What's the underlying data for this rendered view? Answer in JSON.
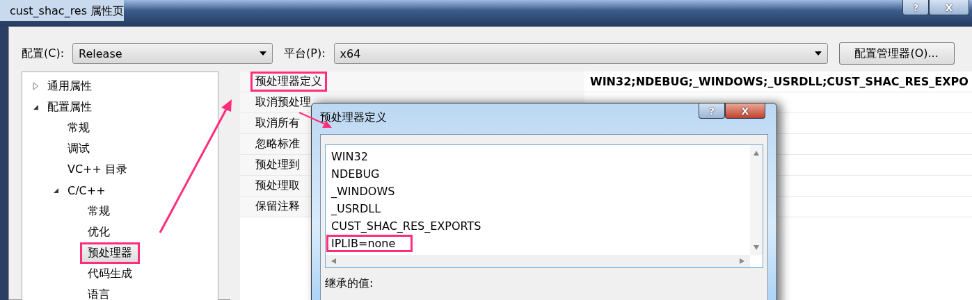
{
  "window": {
    "title": "cust_shac_res 属性页",
    "buttons": [
      "?",
      "X"
    ]
  },
  "config": {
    "label": "配置(C):",
    "value": "Release"
  },
  "platform": {
    "label": "平台(P):",
    "value": "x64"
  },
  "manager_button": "配置管理器(O)...",
  "tree": [
    {
      "label": "通用属性",
      "expanded": false,
      "selected": false,
      "highlighted": false
    },
    {
      "label": "配置属性",
      "expanded": true,
      "selected": false,
      "highlighted": false,
      "children": [
        {
          "label": "常规",
          "selected": false,
          "highlighted": false
        },
        {
          "label": "调试",
          "selected": false,
          "highlighted": false
        },
        {
          "label": "VC++ 目录",
          "selected": false,
          "highlighted": false
        },
        {
          "label": "C/C++",
          "expanded": true,
          "selected": false,
          "highlighted": false,
          "children": [
            {
              "label": "常规",
              "selected": false,
              "highlighted": false
            },
            {
              "label": "优化",
              "selected": false,
              "highlighted": false
            },
            {
              "label": "预处理器",
              "selected": true,
              "highlighted": true
            },
            {
              "label": "代码生成",
              "selected": false,
              "highlighted": false
            },
            {
              "label": "语言",
              "selected": false,
              "highlighted": false
            }
          ]
        }
      ]
    }
  ],
  "properties": [
    {
      "name": "预处理器定义",
      "value": "WIN32;NDEBUG;_WINDOWS;_USRDLL;CUST_SHAC_RES_EXPO",
      "highlighted": true
    },
    {
      "name": "取消预处理",
      "highlighted": false
    },
    {
      "name": "取消所有",
      "highlighted": false
    },
    {
      "name": "忽略标准",
      "highlighted": false
    },
    {
      "name": "预处理到",
      "highlighted": false
    },
    {
      "name": "预处理取",
      "highlighted": false
    },
    {
      "name": "保留注释",
      "highlighted": false
    }
  ],
  "dialog": {
    "title": "预处理器定义",
    "buttons": [
      "?",
      "X"
    ],
    "definitions": [
      {
        "text": "WIN32",
        "highlighted": false
      },
      {
        "text": "NDEBUG",
        "highlighted": false
      },
      {
        "text": "_WINDOWS",
        "highlighted": false
      },
      {
        "text": "_USRDLL",
        "highlighted": false
      },
      {
        "text": "CUST_SHAC_RES_EXPORTS",
        "highlighted": false
      },
      {
        "text": "IPLIB=none",
        "highlighted": true
      }
    ],
    "inherited_label": "继承的值:"
  }
}
